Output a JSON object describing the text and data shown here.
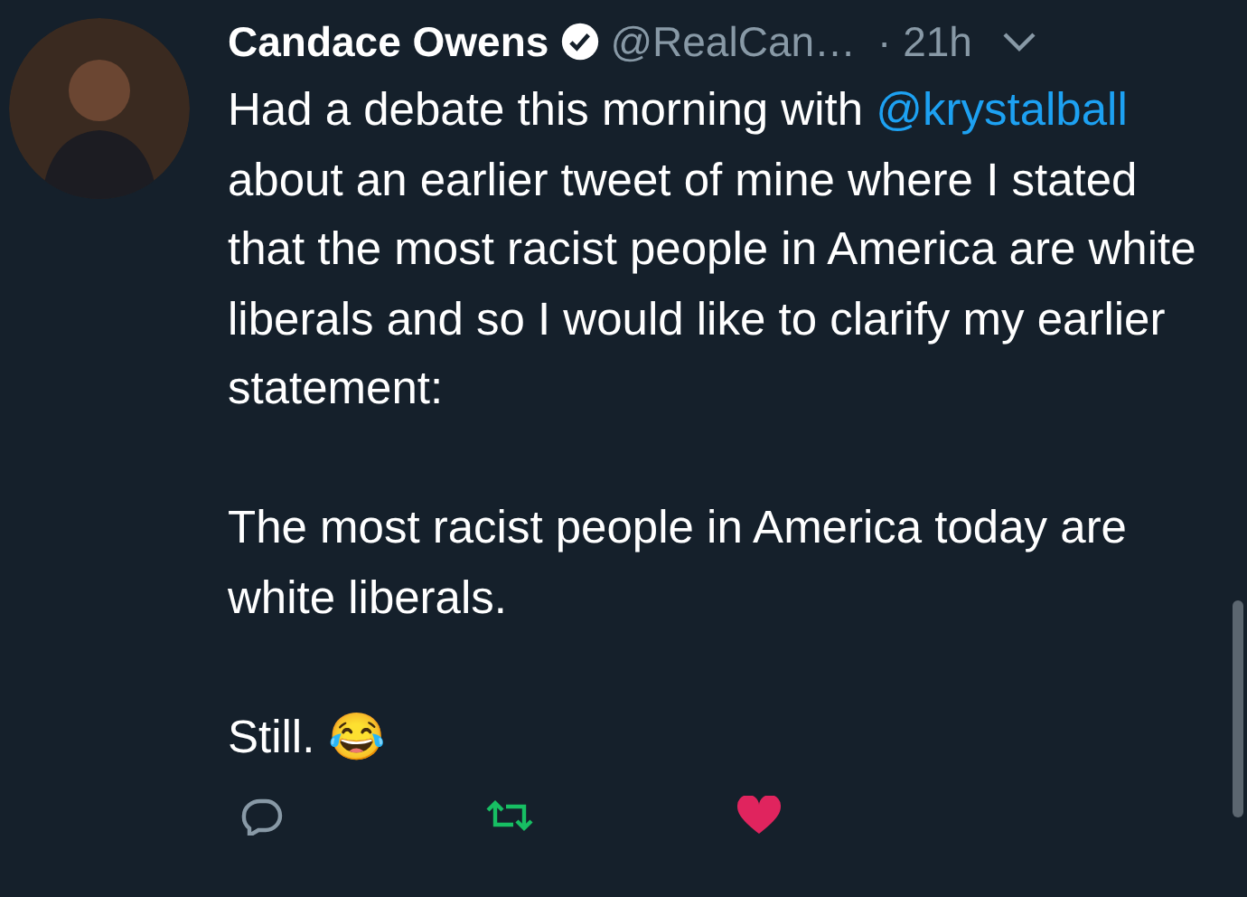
{
  "tweet": {
    "author": {
      "name": "Candace Owens",
      "verified": true,
      "handle": "@RealCan…",
      "time": "· 21h"
    },
    "paragraphs": [
      {
        "segments": [
          {
            "kind": "text",
            "text": "Had a debate this morning with "
          },
          {
            "kind": "mention",
            "text": "@krystalball"
          },
          {
            "kind": "text",
            "text": " about an earlier tweet of mine where I stated that the most racist people in America are white liberals and so I would like to clarify my earlier statement:"
          }
        ]
      },
      {
        "segments": [
          {
            "kind": "text",
            "text": "The most racist people in America today are white liberals."
          }
        ]
      },
      {
        "segments": [
          {
            "kind": "text",
            "text": "Still. 😂"
          }
        ]
      }
    ],
    "actions": [
      {
        "kind": "reply"
      },
      {
        "kind": "retweet"
      },
      {
        "kind": "like"
      }
    ]
  }
}
